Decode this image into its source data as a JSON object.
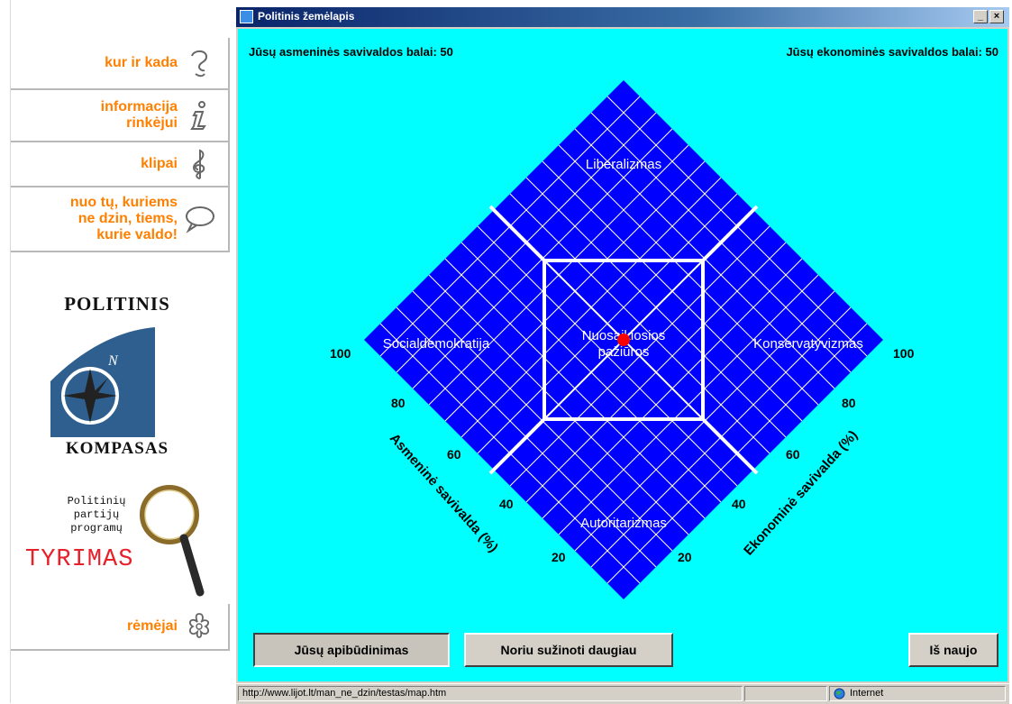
{
  "sidebar": {
    "menu": [
      {
        "lines": [
          "kur ir kada"
        ],
        "icon": "question-icon"
      },
      {
        "lines": [
          "informacija",
          "rinkėjui"
        ],
        "icon": "info-icon"
      },
      {
        "lines": [
          "klipai"
        ],
        "icon": "music-clef-icon"
      },
      {
        "lines": [
          "nuo tų, kuriems",
          "ne dzin, tiems,",
          "kurie valdo!"
        ],
        "icon": "speech-bubble-icon"
      }
    ],
    "logo": {
      "top": "POLITINIS",
      "bottom": "KOMPASAS",
      "compass_letter": "N"
    },
    "survey": {
      "lines": [
        "Politinių",
        "partijų",
        "programų"
      ],
      "title": "TYRIMAS"
    },
    "sponsors": {
      "label": "rėmėjai",
      "icon": "flower-icon"
    }
  },
  "window": {
    "title": "Politinis žemėlapis",
    "minimize": "_",
    "close": "×",
    "personal_score": "Jūsų asmeninės savivaldos balai: 50",
    "economic_score": "Jūsų ekonominės savivaldos balai: 50"
  },
  "map": {
    "regions": {
      "top": "Liberalizmas",
      "left": "Socialdemokratija",
      "right": "Konservatyvizmas",
      "center_line1": "Nuosaikiosios",
      "center_line2": "pažiūros",
      "bottom": "Autoritarizmas"
    },
    "left_axis": {
      "label": "Asmeninė savivalda (%)",
      "ticks": [
        "100",
        "80",
        "60",
        "40",
        "20"
      ]
    },
    "right_axis": {
      "label": "Ekonominė savivalda (%)",
      "ticks": [
        "100",
        "80",
        "60",
        "40",
        "20"
      ]
    },
    "marker": {
      "personal": 50,
      "economic": 50,
      "color": "#ff0000"
    },
    "colors": {
      "grid": "#0000ff",
      "background": "#00ffff",
      "lines": "#ffffff"
    }
  },
  "buttons": {
    "description": "Jūsų apibūdinimas",
    "learn_more": "Noriu sužinoti daugiau",
    "restart": "Iš naujo"
  },
  "status": {
    "url": "http://www.lijot.lt/man_ne_dzin/testas/map.htm",
    "zone": "Internet"
  }
}
